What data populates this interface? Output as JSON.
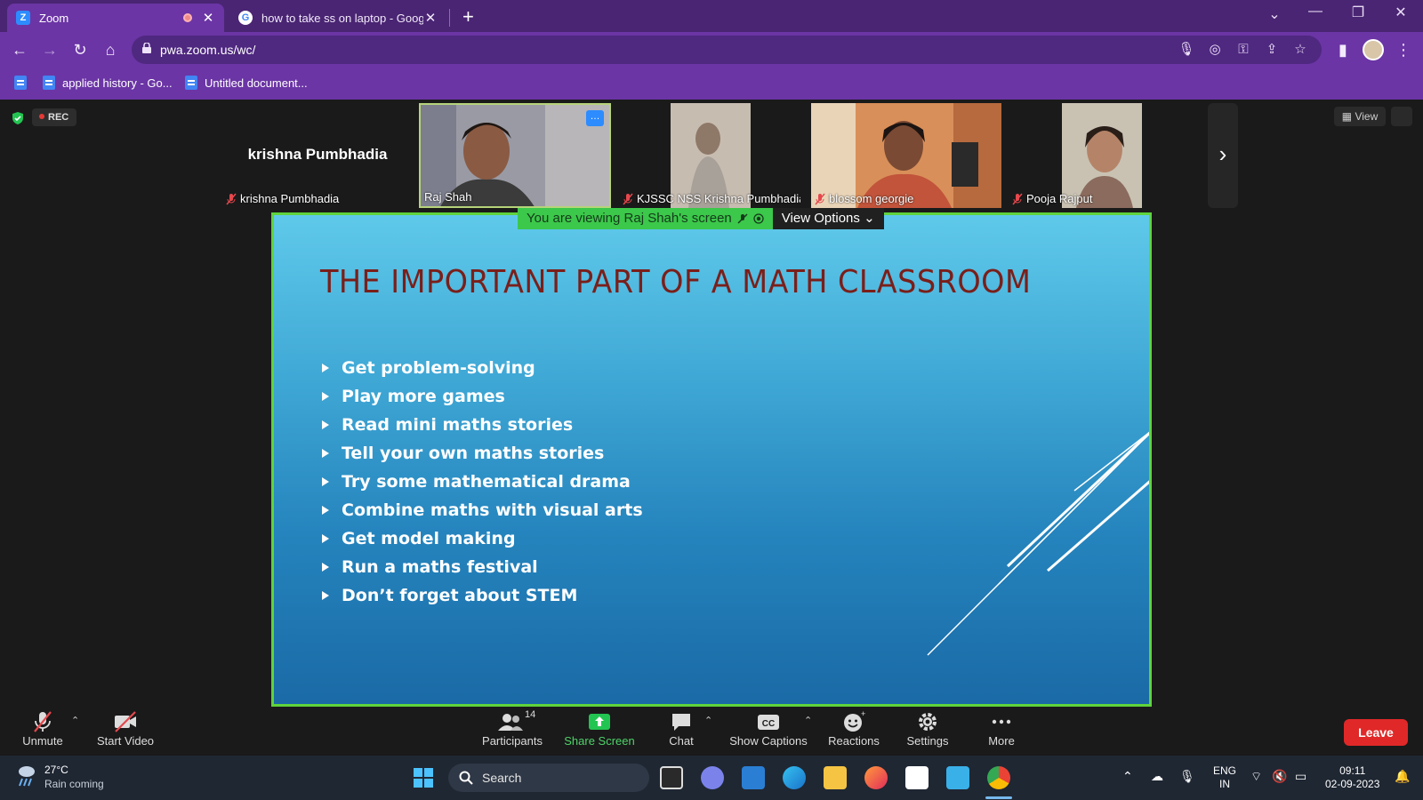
{
  "browser": {
    "tabs": [
      {
        "title": "Zoom",
        "favicon": "Z"
      },
      {
        "title": "how to take ss on laptop - Google"
      }
    ],
    "url": "pwa.zoom.us/wc/",
    "bookmarks": [
      "applied history - Go...",
      "Untitled document..."
    ]
  },
  "zoom": {
    "rec_label": "REC",
    "participants": [
      {
        "name": "krishna Pumbhadia",
        "big_name": "krishna Pumbhadia",
        "muted": true
      },
      {
        "name": "Raj Shah",
        "muted": false
      },
      {
        "name": "KJSSC NSS Krishna Pumbhadia",
        "muted": true
      },
      {
        "name": "blossom georgie",
        "muted": true
      },
      {
        "name": "Pooja Rajput",
        "muted": true
      }
    ],
    "view_label": "View",
    "banner": {
      "viewing": "You are viewing Raj Shah's screen",
      "options": "View Options"
    },
    "slide": {
      "title": "THE IMPORTANT PART OF A MATH CLASSROOM",
      "bullets": [
        "Get problem-solving",
        "Play more games",
        "Read mini maths stories",
        "Tell your own maths stories",
        "Try some mathematical drama",
        "Combine maths with visual arts",
        "Get model making",
        "Run a maths festival",
        "Don’t forget about STEM"
      ]
    },
    "toolbar": {
      "unmute": "Unmute",
      "start_video": "Start Video",
      "participants": "Participants",
      "participants_count": "14",
      "share_screen": "Share Screen",
      "chat": "Chat",
      "show_captions": "Show Captions",
      "reactions": "Reactions",
      "settings": "Settings",
      "more": "More",
      "leave": "Leave"
    }
  },
  "taskbar": {
    "temperature": "27°C",
    "weather": "Rain coming",
    "search": "Search",
    "lang1": "ENG",
    "lang2": "IN",
    "time": "09:11",
    "date": "02-09-2023"
  },
  "colors": {
    "accent": "#6b35a5",
    "share_green": "#3cc84a",
    "leave_red": "#e02828",
    "slide_border": "#5fd33b"
  }
}
